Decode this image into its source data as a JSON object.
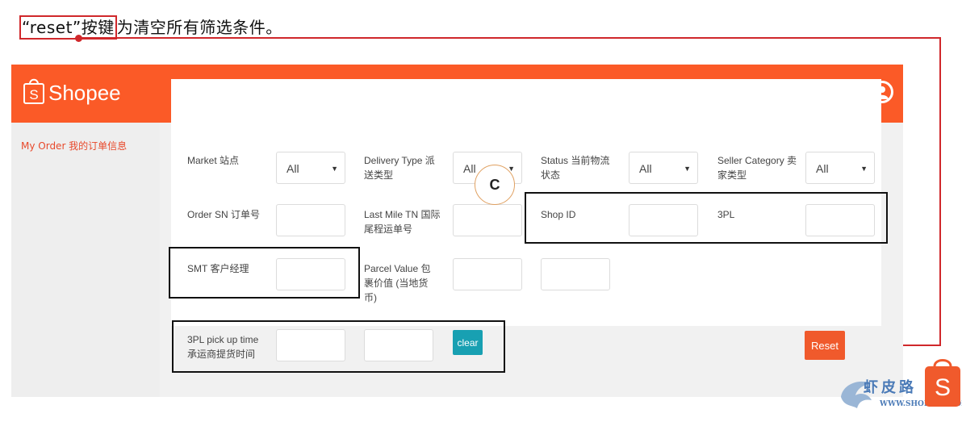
{
  "caption": {
    "highlight": "“reset”按键",
    "rest": "为清空所有筛选条件。"
  },
  "header": {
    "logo_text": "Shopee",
    "user_icon": "user-circle-icon"
  },
  "sidebar": {
    "items": [
      {
        "label": "My Order 我的订单信息"
      }
    ]
  },
  "filters": {
    "market_label": "Market 站点",
    "market_value": "All",
    "delivery_type_label": "Delivery Type 派送类型",
    "delivery_type_value": "All",
    "status_label": "Status 当前物流状态",
    "status_value": "All",
    "seller_category_label": "Seller Category 卖家类型",
    "seller_category_value": "All",
    "order_sn_label": "Order SN 订单号",
    "last_mile_label": "Last Mile TN 国际尾程运单号",
    "shop_id_label": "Shop ID",
    "tpl_label": "3PL",
    "smt_label": "SMT 客户经理",
    "parcel_value_label": "Parcel Value 包裹价值 (当地货币)",
    "pickup_time_label": "3PL pick up time 承运商提货时间"
  },
  "buttons": {
    "clear": "clear",
    "reset": "Reset"
  },
  "annotation": {
    "badge": "C"
  },
  "watermark": {
    "name": "虾皮路",
    "url": "WWW.SHOPEEB.COM"
  },
  "colors": {
    "brand": "#fb5a27",
    "callout": "#d0282b",
    "clear_button": "#18a0b2",
    "reset_button": "#f05a2c"
  }
}
